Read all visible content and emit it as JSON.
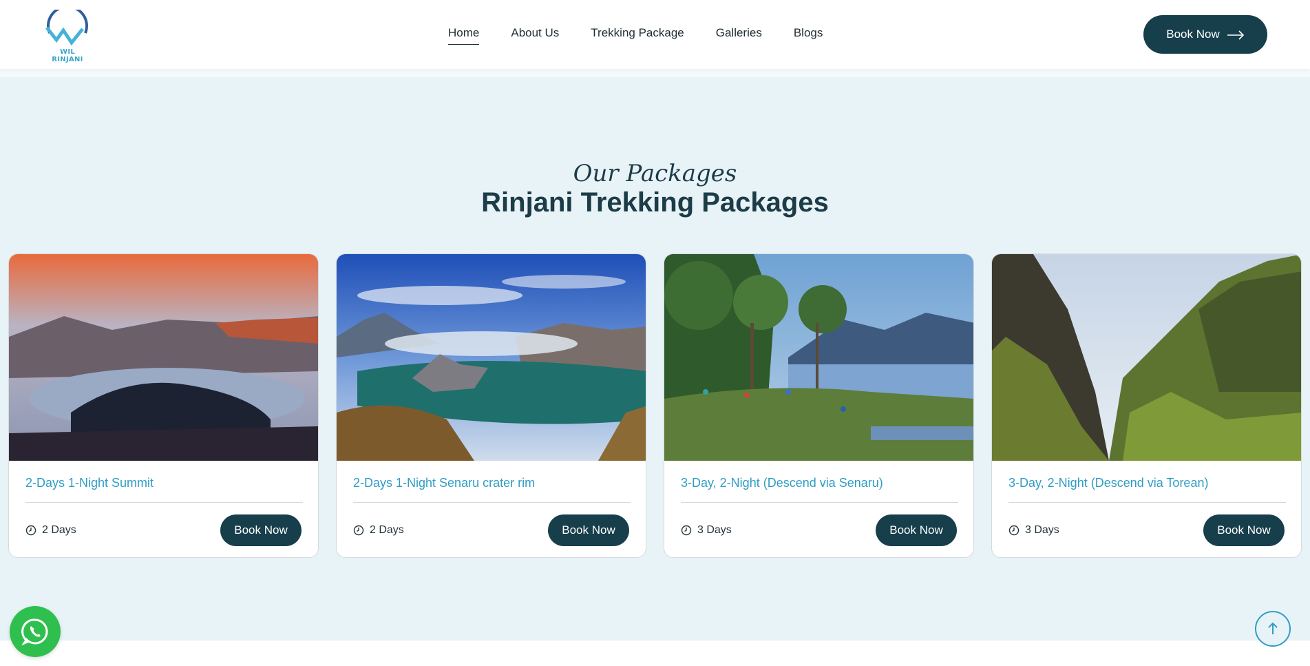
{
  "header": {
    "logo_text": "WIL RINJANI",
    "nav": [
      {
        "label": "Home",
        "active": true
      },
      {
        "label": "About Us",
        "active": false
      },
      {
        "label": "Trekking Package",
        "active": false
      },
      {
        "label": "Galleries",
        "active": false
      },
      {
        "label": "Blogs",
        "active": false
      }
    ],
    "book_now_label": "Book Now",
    "icons": {
      "book_now": "arrow-right-icon"
    }
  },
  "packages_section": {
    "subtitle": "Our Packages",
    "title": "Rinjani Trekking Packages",
    "cards": [
      {
        "title": "2-Days 1-Night Summit",
        "duration": "2 Days",
        "button": "Book Now",
        "image": "rinjani-crater-sunset"
      },
      {
        "title": "2-Days 1-Night Senaru crater rim",
        "duration": "2 Days",
        "button": "Book Now",
        "image": "segara-anak-lake-view"
      },
      {
        "title": "3-Day, 2-Night (Descend via Senaru)",
        "duration": "3 Days",
        "button": "Book Now",
        "image": "lakeside-camp-trees"
      },
      {
        "title": "3-Day, 2-Night (Descend via Torean)",
        "duration": "3 Days",
        "button": "Book Now",
        "image": "torean-green-valley"
      }
    ]
  },
  "floating": {
    "whatsapp_icon": "whatsapp-icon",
    "scroll_top_icon": "arrow-up-icon"
  },
  "colors": {
    "primary_dark": "#163e4b",
    "accent_blue": "#2f9dc4",
    "section_bg": "#e8f3f7",
    "whatsapp_green": "#2fbf4f"
  }
}
